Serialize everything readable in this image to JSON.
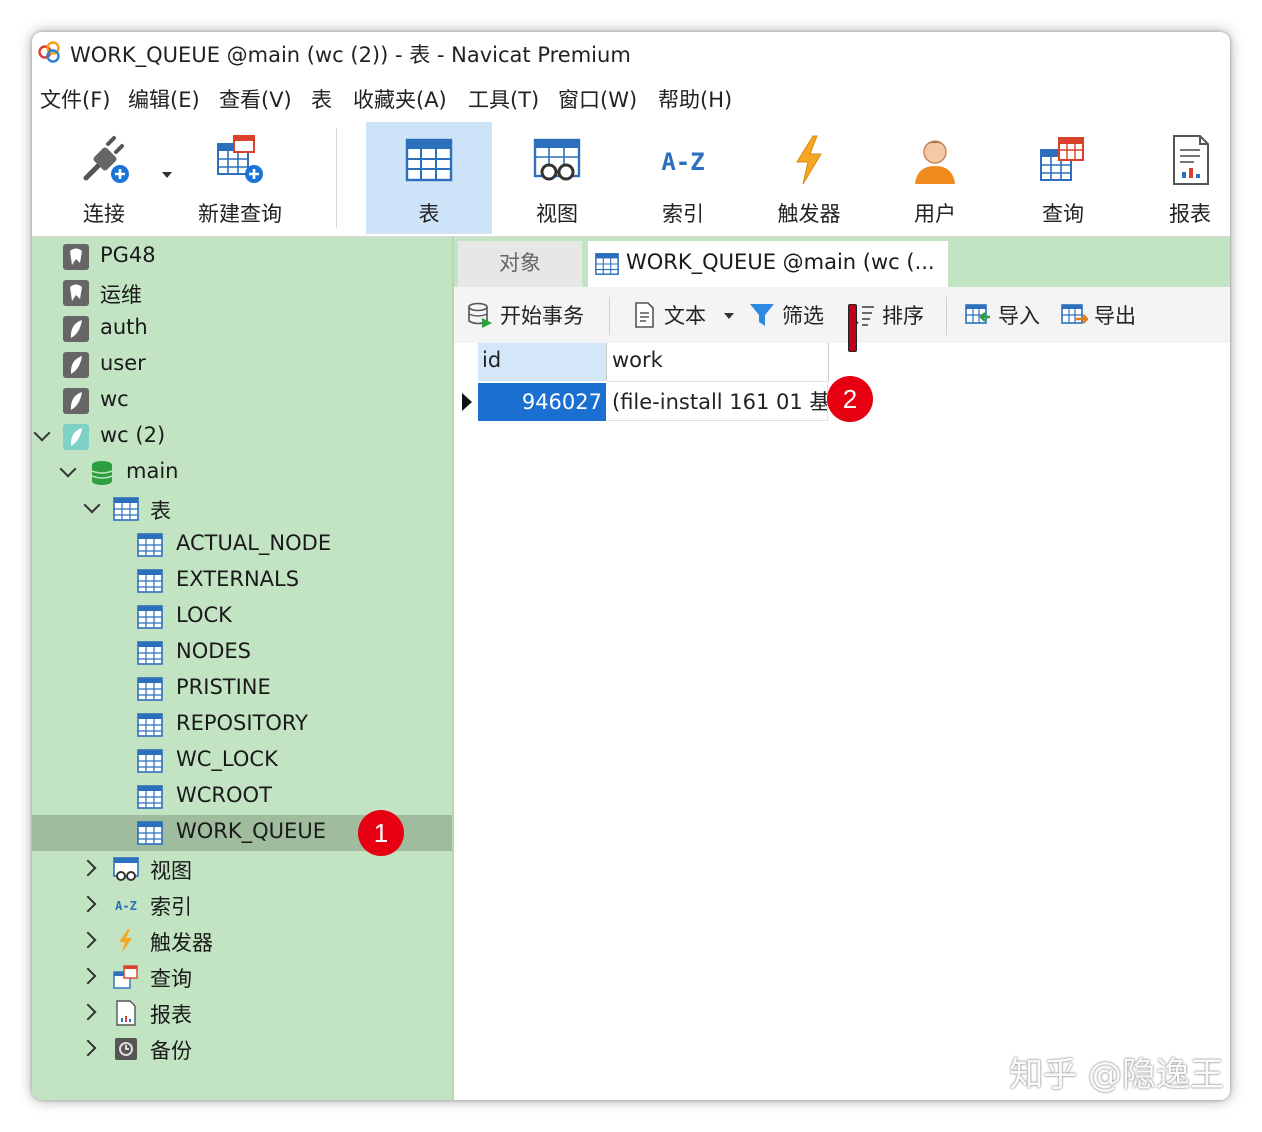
{
  "window": {
    "title": "WORK_QUEUE @main (wc (2)) - 表 - Navicat Premium"
  },
  "menu": [
    "文件(F)",
    "编辑(E)",
    "查看(V)",
    "表",
    "收藏夹(A)",
    "工具(T)",
    "窗口(W)",
    "帮助(H)"
  ],
  "toolbar": {
    "connect": "连接",
    "new_query": "新建查询",
    "table": "表",
    "view": "视图",
    "index": "索引",
    "trigger": "触发器",
    "user": "用户",
    "query": "查询",
    "report": "报表"
  },
  "sidebar": {
    "connections": [
      "PG48",
      "运维",
      "auth",
      "user",
      "wc",
      "wc (2)"
    ],
    "schema": "main",
    "tables_group": "表",
    "tables": [
      "ACTUAL_NODE",
      "EXTERNALS",
      "LOCK",
      "NODES",
      "PRISTINE",
      "REPOSITORY",
      "WC_LOCK",
      "WCROOT",
      "WORK_QUEUE"
    ],
    "groups": [
      "视图",
      "索引",
      "触发器",
      "查询",
      "报表",
      "备份"
    ]
  },
  "tabs": {
    "objects": "对象",
    "current": "WORK_QUEUE @main (wc (..."
  },
  "data_toolbar": {
    "begin_transaction": "开始事务",
    "text": "文本",
    "filter": "筛选",
    "sort": "排序",
    "import": "导入",
    "export": "导出"
  },
  "grid": {
    "columns": [
      "id",
      "work"
    ],
    "rows": [
      {
        "id": "946027",
        "work": "(file-install 161 01 基"
      }
    ]
  },
  "annotations": {
    "badge1": "1",
    "badge2": "2"
  },
  "watermark": "知乎 @隐逸王",
  "colors": {
    "sidebar_bg": "#c2e4c3",
    "selection": "#1a6fd1",
    "badge": "#e60012"
  }
}
